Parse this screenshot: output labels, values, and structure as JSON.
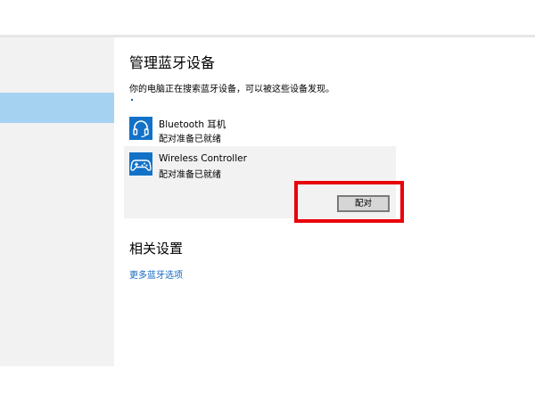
{
  "page_title": "管理蓝牙设备",
  "subtitle": "你的电脑正在搜索蓝牙设备，可以被这些设备发现。",
  "devices": [
    {
      "name": "Bluetooth 耳机",
      "status": "配对准备已就绪",
      "icon": "headset-icon"
    },
    {
      "name": "Wireless Controller",
      "status": "配对准备已就绪",
      "icon": "gamepad-icon"
    }
  ],
  "pair_label": "配对",
  "related": {
    "title": "相关设置",
    "link": "更多蓝牙选项"
  },
  "colors": {
    "accent": "#1372c8",
    "link": "#1467c2",
    "highlight": "#e8000b",
    "sidebar": "#f2f2f2",
    "sidebar_selected": "#a6d2f2"
  }
}
